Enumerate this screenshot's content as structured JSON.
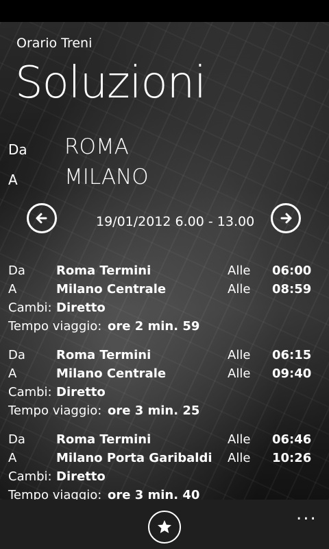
{
  "header": {
    "app_title": "Orario Treni",
    "page_title": "Soluzioni"
  },
  "route": {
    "from_label": "Da",
    "from_value": "ROMA",
    "to_label": "A",
    "to_value": "MILANO"
  },
  "navigation": {
    "date_range": "19/01/2012 6.00 - 13.00",
    "prev_icon": "arrow-left-icon",
    "next_icon": "arrow-right-icon"
  },
  "solutions": [
    {
      "from_label": "Da",
      "from_station": "Roma Termini",
      "dep_label": "Alle",
      "dep_time": "06:00",
      "to_label": "A",
      "to_station": "Milano Centrale",
      "arr_label": "Alle",
      "arr_time": "08:59",
      "changes_label": "Cambi:",
      "changes_value": "Diretto",
      "duration_label": "Tempo viaggio:",
      "duration_value": "ore 2 min. 59"
    },
    {
      "from_label": "Da",
      "from_station": "Roma Termini",
      "dep_label": "Alle",
      "dep_time": "06:15",
      "to_label": "A",
      "to_station": "Milano Centrale",
      "arr_label": "Alle",
      "arr_time": "09:40",
      "changes_label": "Cambi:",
      "changes_value": "Diretto",
      "duration_label": "Tempo viaggio:",
      "duration_value": "ore 3 min. 25"
    },
    {
      "from_label": "Da",
      "from_station": "Roma Termini",
      "dep_label": "Alle",
      "dep_time": "06:46",
      "to_label": "A",
      "to_station": "Milano Porta Garibaldi",
      "arr_label": "Alle",
      "arr_time": "10:26",
      "changes_label": "Cambi:",
      "changes_value": "Diretto",
      "duration_label": "Tempo viaggio:",
      "duration_value": "ore 3 min. 40"
    }
  ],
  "appbar": {
    "favorite_icon": "star-icon",
    "more_icon": "more-icon",
    "more_text": "..."
  }
}
